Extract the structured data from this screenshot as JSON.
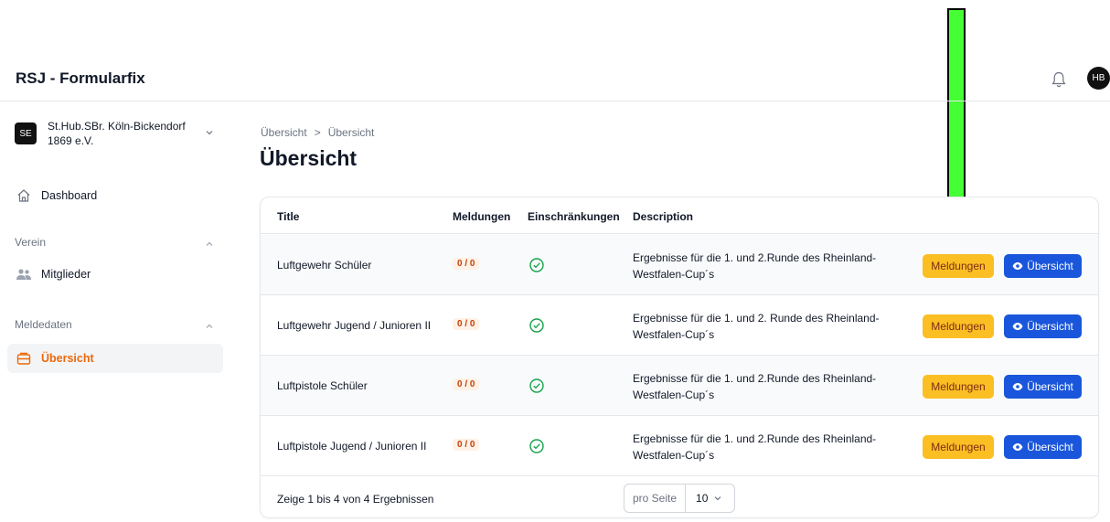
{
  "app": {
    "title": "RSJ - Formularfix",
    "user_initials": "HB"
  },
  "sidebar": {
    "org": {
      "badge": "SE",
      "name": "St.Hub.SBr. Köln-Bickendorf 1869 e.V."
    },
    "dashboard_label": "Dashboard",
    "sections": [
      {
        "label": "Verein",
        "items": [
          {
            "label": "Mitglieder"
          }
        ]
      },
      {
        "label": "Meldedaten",
        "items": [
          {
            "label": "Übersicht"
          }
        ]
      }
    ]
  },
  "breadcrumb": {
    "items": [
      "Übersicht",
      "Übersicht"
    ],
    "separator": ">"
  },
  "page": {
    "title": "Übersicht"
  },
  "table": {
    "columns": [
      "Title",
      "Meldungen",
      "Einschränkungen",
      "Description"
    ],
    "rows": [
      {
        "title": "Luftgewehr Schüler",
        "meldungen": "0 / 0",
        "description": "Ergebnisse für die 1. und 2.Runde des Rheinland-Westfalen-Cup´s"
      },
      {
        "title": "Luftgewehr Jugend / Junioren II",
        "meldungen": "0 / 0",
        "description": "Ergebnisse für die 1. und 2. Runde des Rheinland-Westfalen-Cup´s"
      },
      {
        "title": "Luftpistole Schüler",
        "meldungen": "0 / 0",
        "description": "Ergebnisse für die 1. und 2.Runde des Rheinland-Westfalen-Cup´s"
      },
      {
        "title": "Luftpistole Jugend / Junioren II",
        "meldungen": "0 / 0",
        "description": "Ergebnisse für die 1. und 2.Runde des Rheinland-Westfalen-Cup´s"
      }
    ],
    "meldungen_button": "Meldungen",
    "uebersicht_button": "Übersicht",
    "footer": {
      "summary": "Zeige 1 bis 4 von 4 Ergebnissen",
      "per_page_label": "pro Seite",
      "per_page_value": "10"
    }
  },
  "colors": {
    "accent": "#ea6a0c",
    "meldungen_btn": "#fbbf24",
    "uebersicht_btn": "#1a56db",
    "arrow": "#44ff33"
  }
}
